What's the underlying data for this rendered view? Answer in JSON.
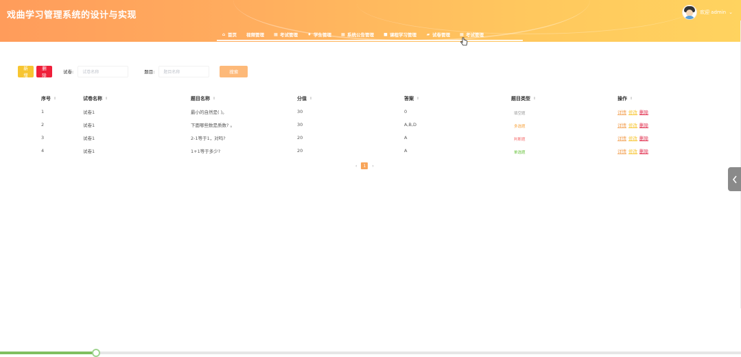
{
  "header": {
    "title": "戏曲学习管理系统的设计与实现",
    "user_label": "欢迎 admin",
    "user_caret": "⌄"
  },
  "nav": {
    "items": [
      {
        "label": "首页",
        "icon": "home-icon",
        "glyph": "⌂"
      },
      {
        "label": "视频管理",
        "icon": "none",
        "glyph": ""
      },
      {
        "label": "考试管理",
        "icon": "table-icon",
        "glyph": "▦"
      },
      {
        "label": "学生管理",
        "icon": "person-icon",
        "glyph": "♦"
      },
      {
        "label": "系统公告管理",
        "icon": "table-icon",
        "glyph": "▦"
      },
      {
        "label": "课程学习管理",
        "icon": "book-icon",
        "glyph": "■"
      },
      {
        "label": "试卷管理",
        "icon": "folder-icon",
        "glyph": "▰"
      },
      {
        "label": "考试管理",
        "icon": "table-icon",
        "glyph": "▦"
      }
    ]
  },
  "toolbar": {
    "add_label": "新增",
    "delete_label": "删除",
    "paper_label": "试卷:",
    "paper_placeholder": "试卷名称",
    "question_label": "题目:",
    "question_placeholder": "题目名称",
    "search_label": "搜索"
  },
  "table": {
    "columns": [
      "序号",
      "试卷名称",
      "题目名称",
      "分值",
      "答案",
      "题目类型",
      "操作"
    ],
    "sort_glyph": "⇕",
    "rows": [
      {
        "no": "1",
        "paper": "试卷1",
        "question": "最小的自然是( )。",
        "score": "30",
        "answer": "0",
        "type": "填空题",
        "type_color": "#999999"
      },
      {
        "no": "2",
        "paper": "试卷1",
        "question": "下面哪些数是质数? 。",
        "score": "30",
        "answer": "A,B,D",
        "type": "多选题",
        "type_color": "#f7a23b"
      },
      {
        "no": "3",
        "paper": "试卷1",
        "question": "2-1等于1，对吗?",
        "score": "20",
        "answer": "A",
        "type": "判断题",
        "type_color": "#f56c6c"
      },
      {
        "no": "4",
        "paper": "试卷1",
        "question": "1+1等于多少?",
        "score": "20",
        "answer": "A",
        "type": "单选题",
        "type_color": "#67c23a"
      }
    ],
    "op_detail": "详情",
    "op_edit": "修改",
    "op_delete": "删除"
  },
  "pager": {
    "prev": "‹",
    "current": "1",
    "next": "›"
  },
  "side_tab": {
    "icon": "chevron-left-icon"
  },
  "progress": {
    "fraction": 0.13
  },
  "colors": {
    "header_start": "#ff9c5b",
    "header_end": "#ffd35f",
    "add_button": "#f7c531",
    "delete_button": "#ef1f3a",
    "search_button": "#fdb979"
  }
}
